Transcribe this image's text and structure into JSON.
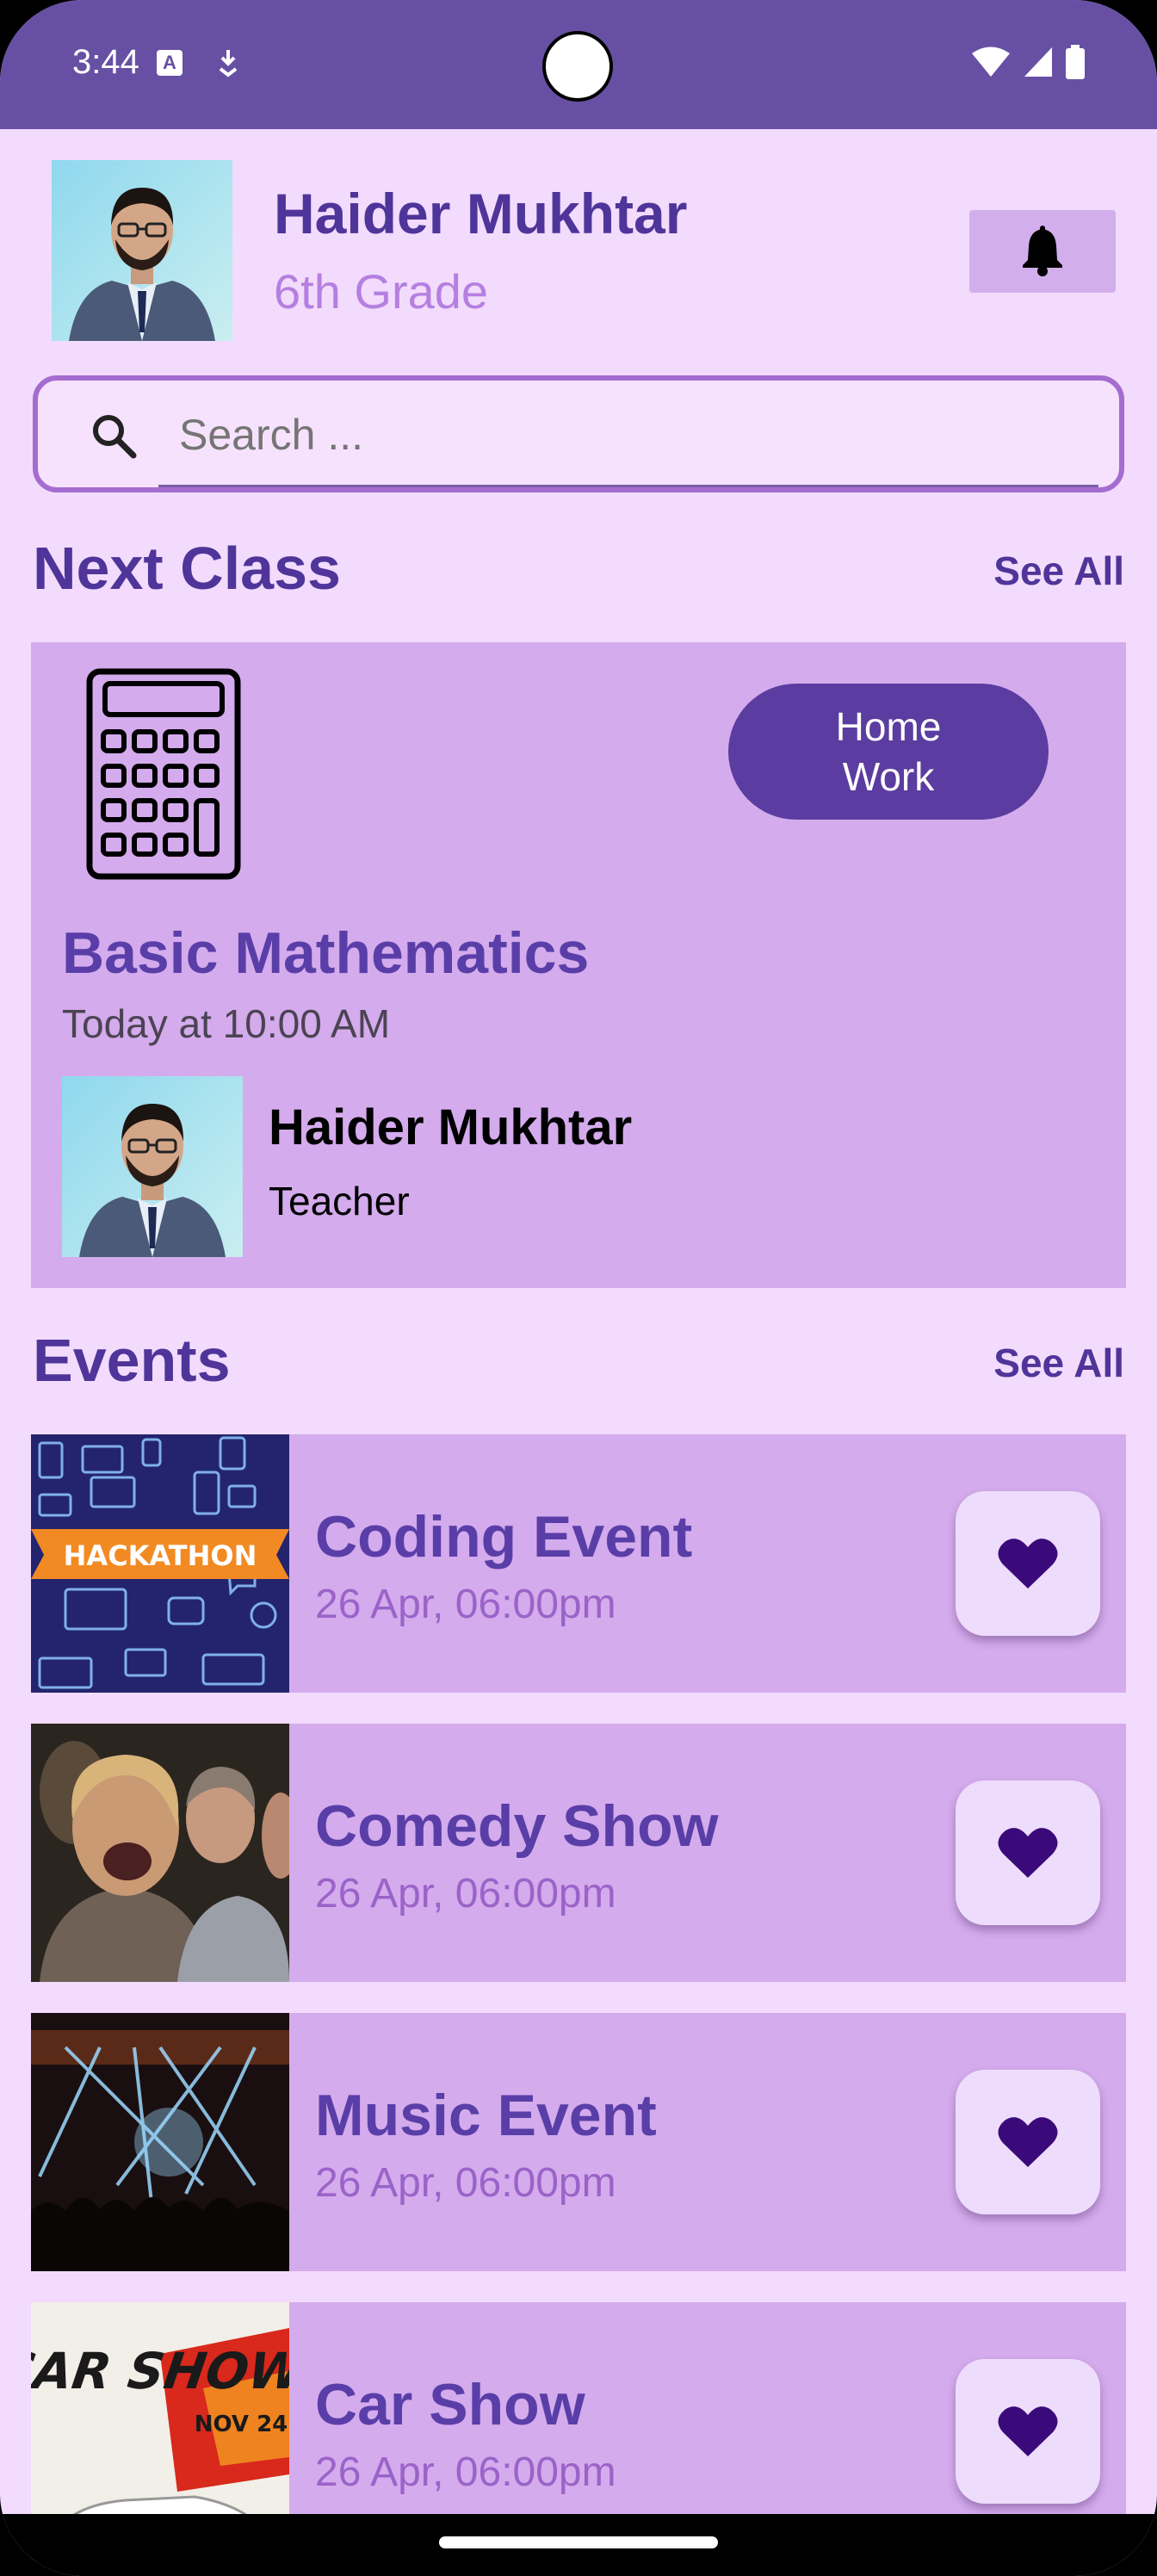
{
  "status_bar": {
    "time": "3:44",
    "notification_letter": "A"
  },
  "header": {
    "name": "Haider Mukhtar",
    "grade": "6th Grade"
  },
  "search": {
    "placeholder": "Search ..."
  },
  "next_class": {
    "section_title": "Next Class",
    "see_all": "See All",
    "homework_label": "Home\nWork",
    "subject": "Basic Mathematics",
    "time": "Today at 10:00 AM",
    "teacher_name": "Haider Mukhtar",
    "teacher_role": "Teacher"
  },
  "events": {
    "section_title": "Events",
    "see_all": "See All",
    "items": [
      {
        "title": "Coding Event",
        "date": "26 Apr, 06:00pm",
        "banner": "HACKATHON"
      },
      {
        "title": "Comedy Show",
        "date": "26 Apr, 06:00pm"
      },
      {
        "title": "Music Event",
        "date": "26 Apr, 06:00pm"
      },
      {
        "title": "Car Show",
        "date": "26 Apr, 06:00pm",
        "poster_title": "CAR SHOW",
        "poster_date": "NOV 24"
      }
    ]
  },
  "colors": {
    "primary": "#6750a4",
    "background": "#f2dbfc",
    "card": "#d4abec",
    "accent_text": "#4f3599",
    "heart": "#3b0a7a"
  }
}
